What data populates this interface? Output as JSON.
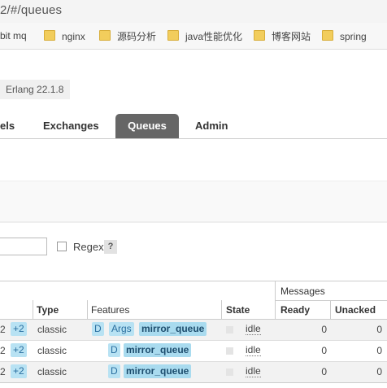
{
  "browser": {
    "address_text": "2/#/queues",
    "bookmarks": [
      "bit mq",
      "nginx",
      "源码分析",
      "java性能优化",
      "博客网站",
      "spring"
    ]
  },
  "header": {
    "erlang_version": "Erlang 22.1.8"
  },
  "tabs": [
    {
      "label": "els"
    },
    {
      "label": "Exchanges"
    },
    {
      "label": "Queues",
      "active": true
    },
    {
      "label": "Admin"
    }
  ],
  "filter": {
    "value": "",
    "regex_label": "Regex",
    "help_label": "?"
  },
  "table": {
    "group_header": "Messages",
    "columns": [
      "Type",
      "Features",
      "State",
      "Ready",
      "Unacked"
    ],
    "rows": [
      {
        "node_prefix": "2",
        "node_extra": "+2",
        "type": "classic",
        "features": [
          "D",
          "Args"
        ],
        "policy": "mirror_queue",
        "state": "idle",
        "ready": "0",
        "unacked": "0"
      },
      {
        "node_prefix": "2",
        "node_extra": "+2",
        "type": "classic",
        "features": [
          "D"
        ],
        "policy": "mirror_queue",
        "state": "idle",
        "ready": "0",
        "unacked": "0"
      },
      {
        "node_prefix": "2",
        "node_extra": "+2",
        "type": "classic",
        "features": [
          "D"
        ],
        "policy": "mirror_queue",
        "state": "idle",
        "ready": "0",
        "unacked": "0"
      }
    ]
  }
}
